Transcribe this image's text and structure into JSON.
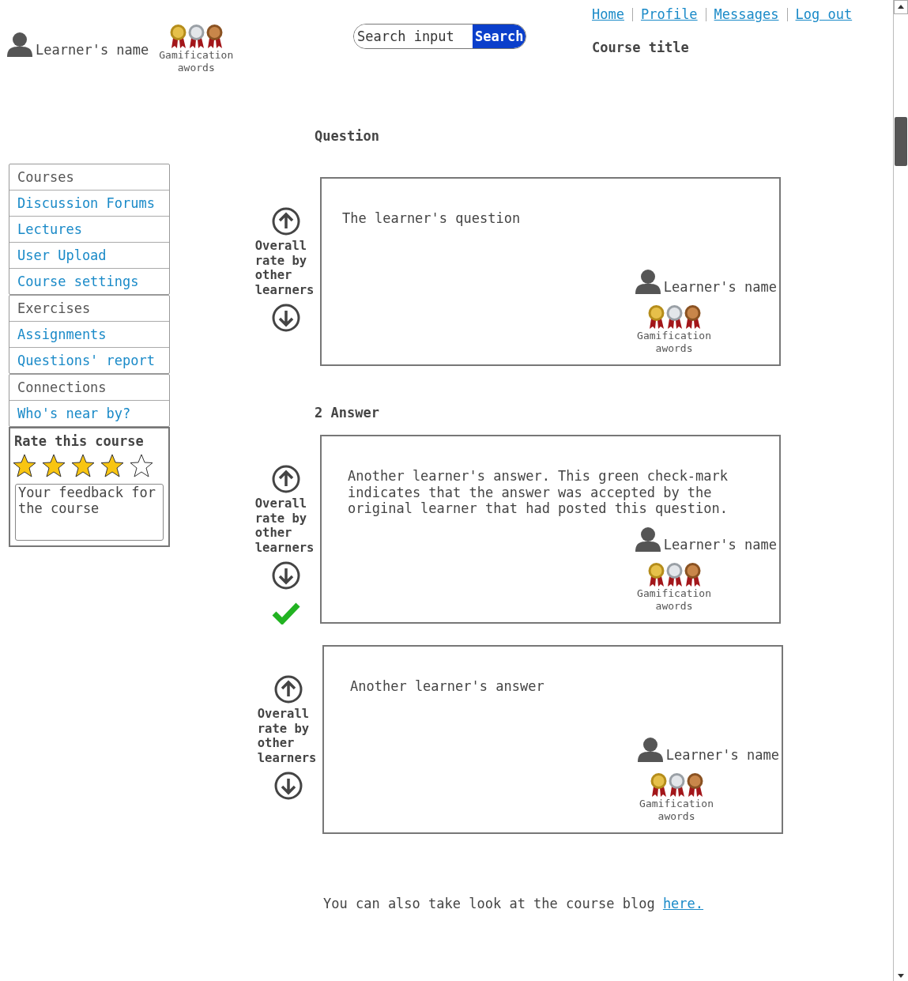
{
  "user": {
    "name": "Learner's name",
    "awards_label": "Gamification awords"
  },
  "search": {
    "placeholder": "Search input",
    "button": "Search"
  },
  "nav_links": [
    "Home",
    "Profile",
    "Messages",
    "Log out"
  ],
  "course_title": "Course title",
  "sidebar": {
    "groups": [
      {
        "title": "Courses",
        "items": [
          "Discussion Forums",
          "Lectures",
          "User Upload",
          "Course settings"
        ]
      },
      {
        "title": "Exercises",
        "items": [
          "Assignments",
          "Questions' report"
        ]
      },
      {
        "title": "Connections",
        "items": [
          "Who's near by?"
        ]
      }
    ]
  },
  "rating": {
    "title": "Rate this course",
    "stars": 4,
    "feedback_placeholder": "Your feedback for the course"
  },
  "question_heading": "Question",
  "question": {
    "vote_label": "Overall rate by other learners",
    "text": "The learner's question",
    "author": "Learner's name",
    "awards_label": "Gamification awords",
    "accepted": false
  },
  "answers_heading": "2 Answer",
  "answers": [
    {
      "vote_label": "Overall rate by other learners",
      "text": "Another learner's answer. This green check-mark indicates that the answer was accepted by the original learner that had posted this question.",
      "author": "Learner's name",
      "awards_label": "Gamification awords",
      "accepted": true
    },
    {
      "vote_label": "Overall rate by other learners",
      "text": "Another learner's answer",
      "author": "Learner's name",
      "awards_label": "Gamification awords",
      "accepted": false
    }
  ],
  "footer": {
    "text": "You can also take look at the course blog ",
    "link": "here."
  }
}
